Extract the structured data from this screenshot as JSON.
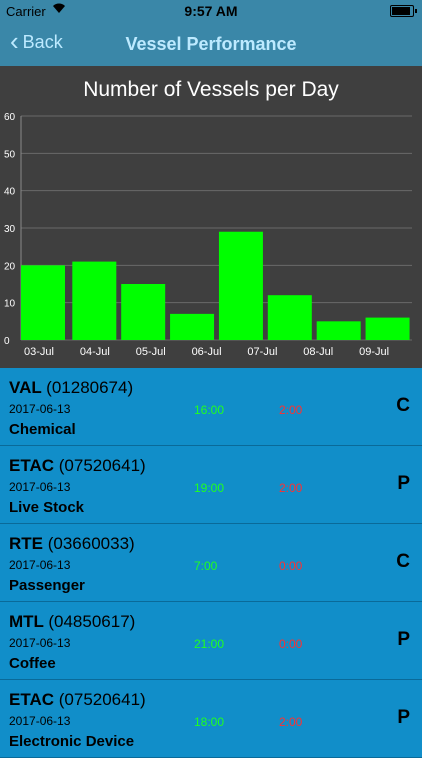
{
  "status_bar": {
    "carrier": "Carrier",
    "wifi_icon": "wifi-icon",
    "time": "9:57 AM",
    "battery_icon": "battery-icon"
  },
  "navbar": {
    "back_label": "Back",
    "back_icon": "chevron-left-icon",
    "title": "Vessel Performance"
  },
  "chart_data": {
    "type": "bar",
    "title": "Number of Vessels per Day",
    "categories": [
      "03-Jul",
      "04-Jul",
      "05-Jul",
      "06-Jul",
      "07-Jul",
      "08-Jul",
      "09-Jul"
    ],
    "values": [
      20,
      21,
      15,
      7,
      29,
      12,
      5,
      6
    ],
    "y_ticks": [
      0,
      10,
      20,
      30,
      40,
      50,
      60
    ],
    "ylim": [
      0,
      60
    ],
    "bar_color": "#00ff00",
    "background": "#3f3f3f",
    "grid": true
  },
  "colors": {
    "navbar": "#3a87a8",
    "list_background": "#118ec9",
    "start_time": "#20ff20",
    "end_time": "#ff3030"
  },
  "vessels": [
    {
      "name": "VAL",
      "id": "(01280674)",
      "date": "2017-06-13",
      "start": "16:00",
      "end": "2:00",
      "cargo": "Chemical",
      "code": "C"
    },
    {
      "name": "ETAC",
      "id": "(07520641)",
      "date": "2017-06-13",
      "start": "19:00",
      "end": "2:00",
      "cargo": "Live Stock",
      "code": "P"
    },
    {
      "name": "RTE",
      "id": "(03660033)",
      "date": "2017-06-13",
      "start": "7:00",
      "end": "0:00",
      "cargo": "Passenger",
      "code": "C"
    },
    {
      "name": "MTL",
      "id": "(04850617)",
      "date": "2017-06-13",
      "start": "21:00",
      "end": "0:00",
      "cargo": "Coffee",
      "code": "P"
    },
    {
      "name": "ETAC",
      "id": "(07520641)",
      "date": "2017-06-13",
      "start": "18:00",
      "end": "2:00",
      "cargo": "Electronic Device",
      "code": "P"
    }
  ]
}
